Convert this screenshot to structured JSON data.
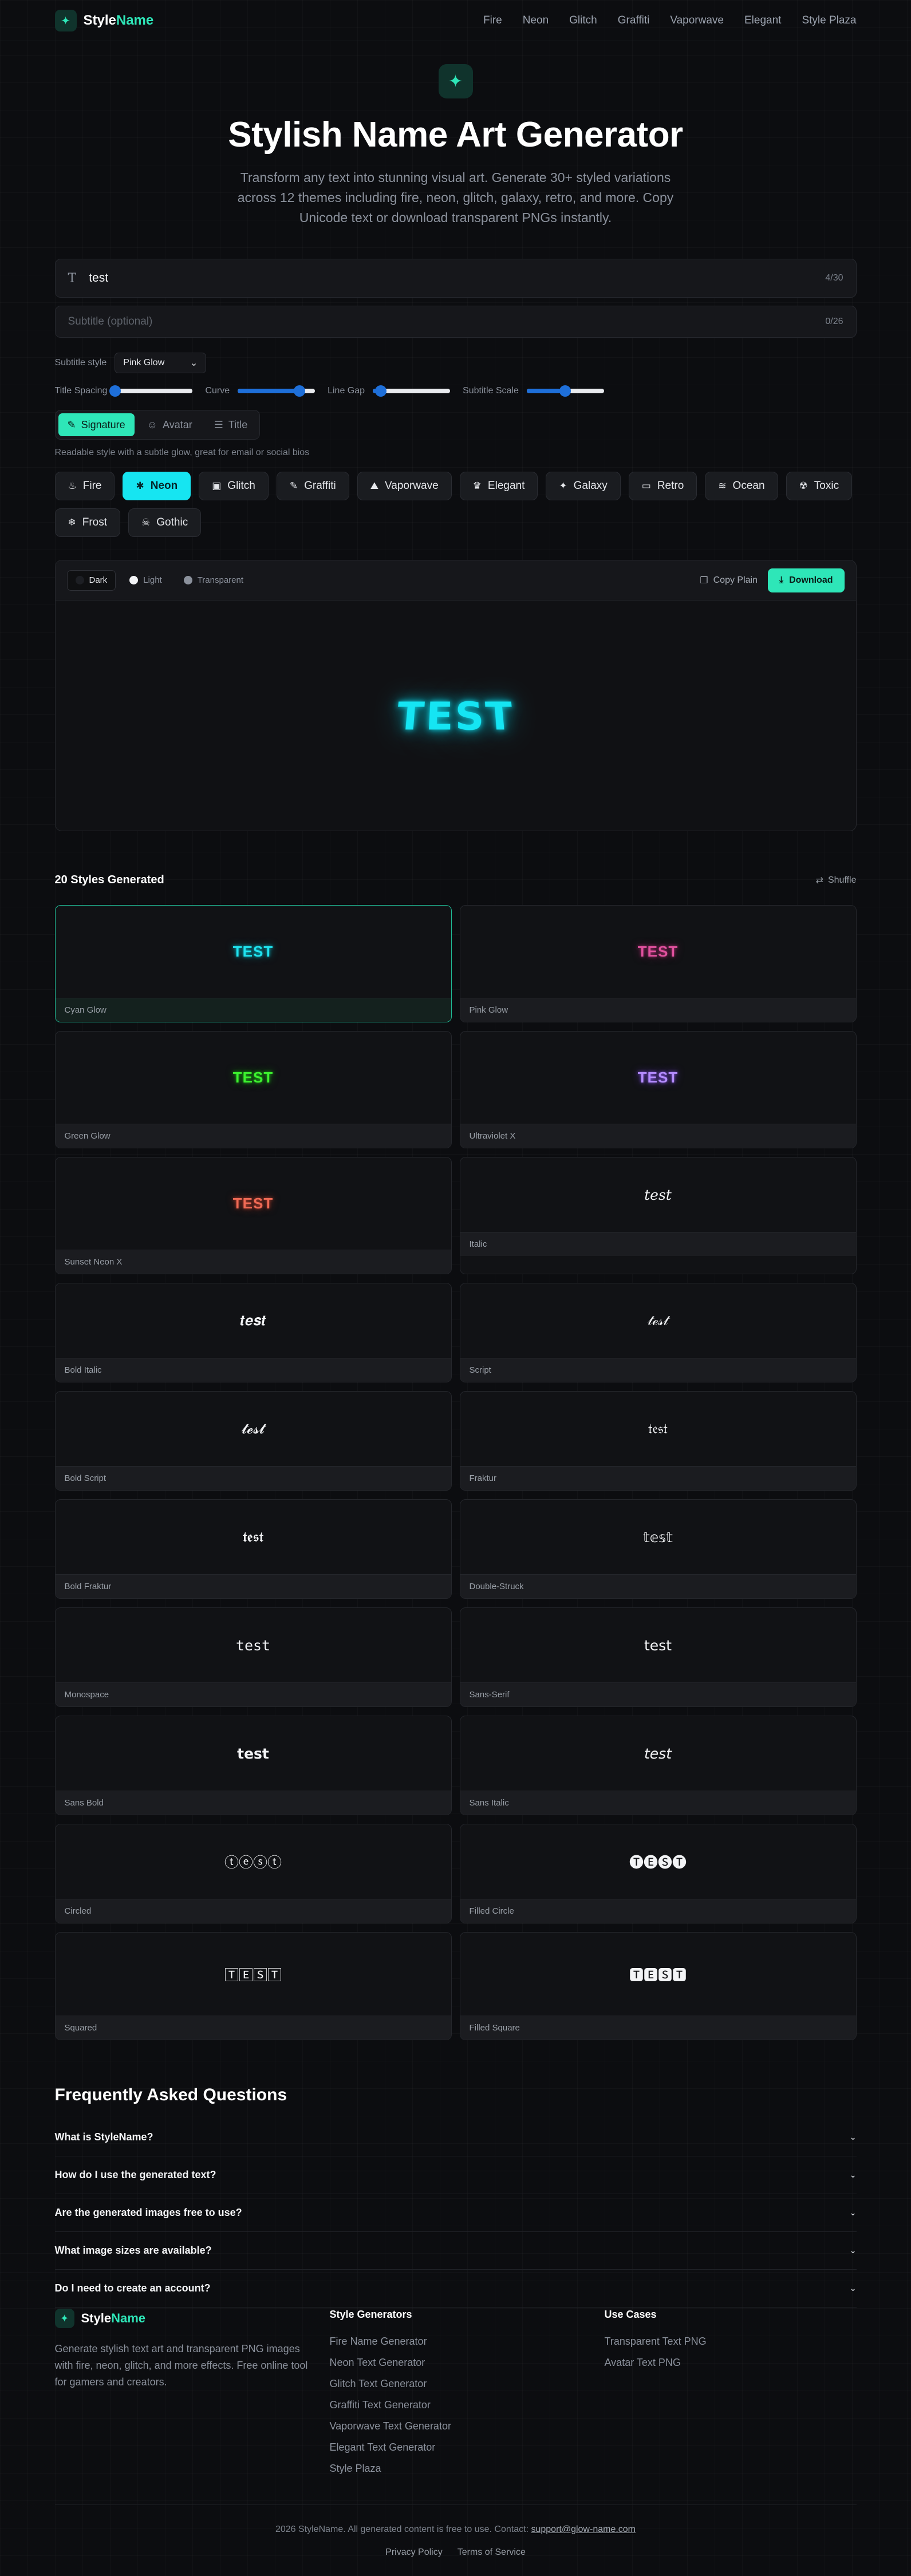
{
  "brand": {
    "name_part1": "Style",
    "name_part2": "Name",
    "accent": "#2ee6b8"
  },
  "nav": [
    "Fire",
    "Neon",
    "Glitch",
    "Graffiti",
    "Vaporwave",
    "Elegant",
    "Style Plaza"
  ],
  "hero": {
    "title": "Stylish Name Art Generator",
    "subtitle": "Transform any text into stunning visual art. Generate 30+ styled variations across 12 themes including fire, neon, glitch, galaxy, retro, and more. Copy Unicode text or download transparent PNGs instantly."
  },
  "inputs": {
    "title_value": "test",
    "title_count": "4/30",
    "subtitle_placeholder": "Subtitle (optional)",
    "subtitle_count": "0/26"
  },
  "subtitle_style": {
    "label": "Subtitle style",
    "value": "Pink Glow"
  },
  "sliders": [
    {
      "label": "Title Spacing",
      "value": 0
    },
    {
      "label": "Curve",
      "value": 0.8
    },
    {
      "label": "Line Gap",
      "value": 0.1
    },
    {
      "label": "Subtitle Scale",
      "value": 0.5
    }
  ],
  "modes": [
    {
      "label": "Signature",
      "icon": "pen-icon",
      "active": true
    },
    {
      "label": "Avatar",
      "icon": "user-icon",
      "active": false
    },
    {
      "label": "Title",
      "icon": "sliders-icon",
      "active": false
    }
  ],
  "mode_description": "Readable style with a subtle glow, great for email or social bios",
  "themes": [
    {
      "label": "Fire",
      "glyph": "♨",
      "active": false
    },
    {
      "label": "Neon",
      "glyph": "✱",
      "active": true
    },
    {
      "label": "Glitch",
      "glyph": "▣",
      "active": false
    },
    {
      "label": "Graffiti",
      "glyph": "✎",
      "active": false
    },
    {
      "label": "Vaporwave",
      "glyph": "⛰",
      "active": false
    },
    {
      "label": "Elegant",
      "glyph": "♛",
      "active": false
    },
    {
      "label": "Galaxy",
      "glyph": "✦",
      "active": false
    },
    {
      "label": "Retro",
      "glyph": "▭",
      "active": false
    },
    {
      "label": "Ocean",
      "glyph": "≋",
      "active": false
    },
    {
      "label": "Toxic",
      "glyph": "☢",
      "active": false
    },
    {
      "label": "Frost",
      "glyph": "❄",
      "active": false
    },
    {
      "label": "Gothic",
      "glyph": "☠",
      "active": false
    }
  ],
  "preview": {
    "backgrounds": [
      {
        "label": "Dark",
        "color": "#1d1f24",
        "active": true
      },
      {
        "label": "Light",
        "color": "#f3f4f6",
        "active": false
      },
      {
        "label": "Transparent",
        "color": "#8b919c",
        "active": false
      }
    ],
    "copy_label": "Copy Plain",
    "download_label": "Download",
    "text": "TEST"
  },
  "results": {
    "heading": "20 Styles Generated",
    "shuffle_label": "Shuffle",
    "cards": [
      {
        "label": "Cyan Glow",
        "text": "TEST",
        "kind": "n-cyan",
        "selected": true
      },
      {
        "label": "Pink Glow",
        "text": "TEST",
        "kind": "n-pink",
        "selected": false
      },
      {
        "label": "Green Glow",
        "text": "TEST",
        "kind": "n-green",
        "selected": false
      },
      {
        "label": "Ultraviolet X",
        "text": "TEST",
        "kind": "n-violet",
        "selected": false
      },
      {
        "label": "Sunset Neon X",
        "text": "TEST",
        "kind": "n-sunset",
        "selected": false
      },
      {
        "label": "Italic",
        "text": "𝑡𝑒𝑠𝑡",
        "kind": "uni serif",
        "selected": false
      },
      {
        "label": "Bold Italic",
        "text": "𝒕𝒆𝒔𝒕",
        "kind": "uni serif",
        "selected": false
      },
      {
        "label": "Script",
        "text": "𝓉ℯ𝓈𝓉",
        "kind": "uni serif",
        "selected": false
      },
      {
        "label": "Bold Script",
        "text": "𝓽𝓮𝓼𝓽",
        "kind": "uni serif",
        "selected": false
      },
      {
        "label": "Fraktur",
        "text": "𝔱𝔢𝔰𝔱",
        "kind": "uni serif",
        "selected": false
      },
      {
        "label": "Bold Fraktur",
        "text": "𝖙𝖊𝖘𝖙",
        "kind": "uni serif",
        "selected": false
      },
      {
        "label": "Double-Struck",
        "text": "𝕥𝕖𝕤𝕥",
        "kind": "uni",
        "selected": false
      },
      {
        "label": "Monospace",
        "text": "𝚝𝚎𝚜𝚝",
        "kind": "uni mono",
        "selected": false
      },
      {
        "label": "Sans-Serif",
        "text": "𝗍𝖾𝗌𝗍",
        "kind": "uni",
        "selected": false
      },
      {
        "label": "Sans Bold",
        "text": "𝘁𝗲𝘀𝘁",
        "kind": "uni",
        "selected": false
      },
      {
        "label": "Sans Italic",
        "text": "𝘵𝘦𝘴𝘵",
        "kind": "uni",
        "selected": false
      },
      {
        "label": "Circled",
        "text": "ⓣⓔⓢⓣ",
        "kind": "uni",
        "selected": false
      },
      {
        "label": "Filled Circle",
        "text": "🅣🅔🅢🅣",
        "kind": "uni",
        "selected": false
      },
      {
        "label": "Squared",
        "text": "🅃🄴🅂🅃",
        "kind": "uni",
        "selected": false
      },
      {
        "label": "Filled Square",
        "text": "🆃🅴🆂🆃",
        "kind": "uni",
        "selected": false
      }
    ]
  },
  "faq": {
    "title": "Frequently Asked Questions",
    "items": [
      "What is StyleName?",
      "How do I use the generated text?",
      "Are the generated images free to use?",
      "What image sizes are available?",
      "Do I need to create an account?"
    ]
  },
  "footer": {
    "description": "Generate stylish text art and transparent PNG images with fire, neon, glitch, and more effects. Free online tool for gamers and creators.",
    "generators_title": "Style Generators",
    "generators": [
      "Fire Name Generator",
      "Neon Text Generator",
      "Glitch Text Generator",
      "Graffiti Text Generator",
      "Vaporwave Text Generator",
      "Elegant Text Generator",
      "Style Plaza"
    ],
    "use_cases_title": "Use Cases",
    "use_cases": [
      "Transparent Text PNG",
      "Avatar Text PNG"
    ],
    "copyright": "2026 StyleName. All generated content is free to use. Contact:",
    "email": "support@glow-name.com",
    "links": [
      "Privacy Policy",
      "Terms of Service"
    ]
  }
}
